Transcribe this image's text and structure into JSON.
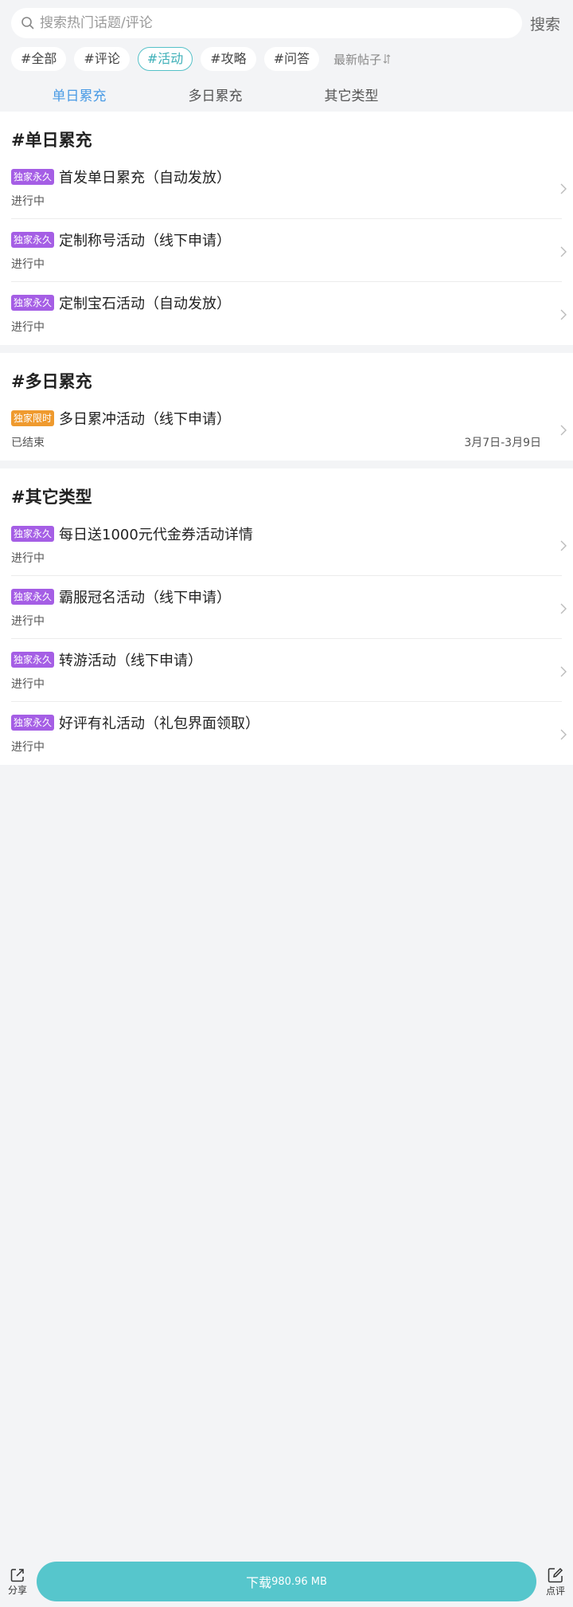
{
  "search": {
    "placeholder": "搜索热门话题/评论",
    "button_label": "搜索"
  },
  "tags": [
    {
      "label": "#全部",
      "active": false
    },
    {
      "label": "#评论",
      "active": false
    },
    {
      "label": "#活动",
      "active": true
    },
    {
      "label": "#攻略",
      "active": false
    },
    {
      "label": "#问答",
      "active": false
    }
  ],
  "sort_label": "最新帖子",
  "subtabs": [
    {
      "label": "单日累充",
      "active": true
    },
    {
      "label": "多日累充",
      "active": false
    },
    {
      "label": "其它类型",
      "active": false
    }
  ],
  "sections": [
    {
      "title": "#单日累充",
      "items": [
        {
          "badge": "独家永久",
          "badge_color": "#a55ee5",
          "title": "首发单日累充（自动发放）",
          "status": "进行中",
          "date": ""
        },
        {
          "badge": "独家永久",
          "badge_color": "#a55ee5",
          "title": "定制称号活动（线下申请）",
          "status": "进行中",
          "date": ""
        },
        {
          "badge": "独家永久",
          "badge_color": "#a55ee5",
          "title": "定制宝石活动（自动发放）",
          "status": "进行中",
          "date": ""
        }
      ]
    },
    {
      "title": "#多日累充",
      "items": [
        {
          "badge": "独家限时",
          "badge_color": "#ef9a2e",
          "title": "多日累冲活动（线下申请）",
          "status": "已结束",
          "date": "3月7日-3月9日"
        }
      ]
    },
    {
      "title": "#其它类型",
      "items": [
        {
          "badge": "独家永久",
          "badge_color": "#a55ee5",
          "title": "每日送1000元代金券活动详情",
          "status": "进行中",
          "date": ""
        },
        {
          "badge": "独家永久",
          "badge_color": "#a55ee5",
          "title": "霸服冠名活动（线下申请）",
          "status": "进行中",
          "date": ""
        },
        {
          "badge": "独家永久",
          "badge_color": "#a55ee5",
          "title": "转游活动（线下申请）",
          "status": "进行中",
          "date": ""
        },
        {
          "badge": "独家永久",
          "badge_color": "#a55ee5",
          "title": "好评有礼活动（礼包界面领取）",
          "status": "进行中",
          "date": ""
        }
      ]
    }
  ],
  "bottom_bar": {
    "share_label": "分享",
    "download_label": "下载",
    "download_size": "980.96 MB",
    "review_label": "点评"
  },
  "colors": {
    "accent": "#56c6cc",
    "tab_active": "#4a9be5",
    "background": "#f3f4f6"
  }
}
